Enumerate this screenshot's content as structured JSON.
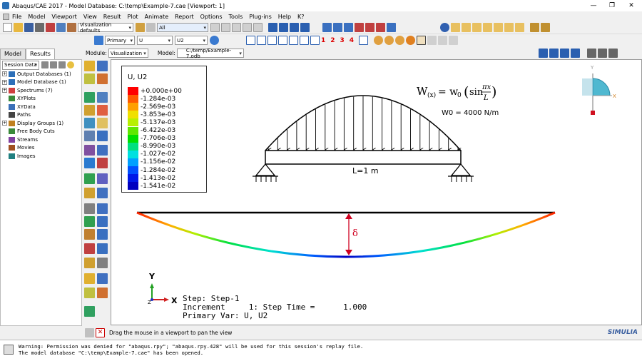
{
  "window": {
    "title": "Abaqus/CAE 2017 - Model Database: C:\\temp\\Example-7.cae [Viewport: 1]"
  },
  "menu": [
    "File",
    "Model",
    "Viewport",
    "View",
    "Result",
    "Plot",
    "Animate",
    "Report",
    "Options",
    "Tools",
    "Plug-ins",
    "Help",
    "K?"
  ],
  "toolbar": {
    "vis_defaults": "Visualization defaults",
    "all_combo": "All",
    "primary_combo": "Primary",
    "u_combo": "U",
    "u2_combo": "U2",
    "numbers": [
      "1",
      "2",
      "3",
      "4"
    ]
  },
  "tabs": [
    "Model",
    "Results"
  ],
  "module": {
    "module_label": "Module:",
    "module_value": "Visualization",
    "model_label": "Model:",
    "model_value": "C:/temp/Example-7.odb"
  },
  "tree": {
    "session_data": "Session Data",
    "items": [
      {
        "label": "Output Databases (1)",
        "expand": true,
        "icon": "database-icon",
        "color": "#2c6fb8"
      },
      {
        "label": "Model Database (1)",
        "expand": true,
        "icon": "database-icon",
        "color": "#2c6fb8"
      },
      {
        "label": "Spectrums (7)",
        "expand": true,
        "icon": "spectrum-icon",
        "color": "#d04040"
      },
      {
        "label": "XYPlots",
        "expand": false,
        "icon": "xyplot-icon",
        "color": "#3a8a3a"
      },
      {
        "label": "XYData",
        "expand": false,
        "icon": "xydata-icon",
        "color": "#3a6fb8"
      },
      {
        "label": "Paths",
        "expand": false,
        "icon": "path-icon",
        "color": "#444444"
      },
      {
        "label": "Display Groups (1)",
        "expand": true,
        "icon": "display-group-icon",
        "color": "#c08020"
      },
      {
        "label": "Free Body Cuts",
        "expand": false,
        "icon": "free-body-icon",
        "color": "#3a8a3a"
      },
      {
        "label": "Streams",
        "expand": false,
        "icon": "stream-icon",
        "color": "#8040a0"
      },
      {
        "label": "Movies",
        "expand": false,
        "icon": "movie-icon",
        "color": "#a05020"
      },
      {
        "label": "Images",
        "expand": false,
        "icon": "image-icon",
        "color": "#208080"
      }
    ]
  },
  "legend": {
    "title": "U, U2",
    "entries": [
      {
        "value": "+0.000e+00",
        "color": "#ff0000"
      },
      {
        "value": "-1.284e-03",
        "color": "#ff5a00"
      },
      {
        "value": "-2.569e-03",
        "color": "#ffa000"
      },
      {
        "value": "-3.853e-03",
        "color": "#f0e000"
      },
      {
        "value": "-5.137e-03",
        "color": "#b8f000"
      },
      {
        "value": "-6.422e-03",
        "color": "#60e800"
      },
      {
        "value": "-7.706e-03",
        "color": "#00e000"
      },
      {
        "value": "-8.990e-03",
        "color": "#00e080"
      },
      {
        "value": "-1.027e-02",
        "color": "#00e0e0"
      },
      {
        "value": "-1.156e-02",
        "color": "#00a0ff"
      },
      {
        "value": "-1.284e-02",
        "color": "#0050ff"
      },
      {
        "value": "-1.413e-02",
        "color": "#0018e8"
      },
      {
        "value": "-1.541e-02",
        "color": "#0000c0"
      }
    ]
  },
  "diagram": {
    "w_lhs": "W",
    "w_sub": "(x)",
    "w_eq": "= w",
    "w0_sub": "0",
    "sin_text": "sin",
    "pi_x": "πx",
    "l_den": "L",
    "w0_value": "W0 = 4000 N/m",
    "length": "L=1 m",
    "delta": "δ"
  },
  "stepinfo": {
    "step": "Step: Step-1",
    "increment": "Increment     1: Step Time =      1.000",
    "primary": "Primary Var: U, U2"
  },
  "triad": {
    "y": "Y",
    "x": "X",
    "z": "Z"
  },
  "view_triad": {
    "y": "Y",
    "x": "X"
  },
  "status": {
    "text": "Drag the mouse in a viewport to pan the view",
    "brand": "SIMULIA"
  },
  "messages": [
    "Warning: Permission was denied for \"abaqus.rpy\"; \"abaqus.rpy.428\" will be used for this session's replay file.",
    "The model database \"C:\\temp\\Example-7.cae\" has been opened."
  ]
}
